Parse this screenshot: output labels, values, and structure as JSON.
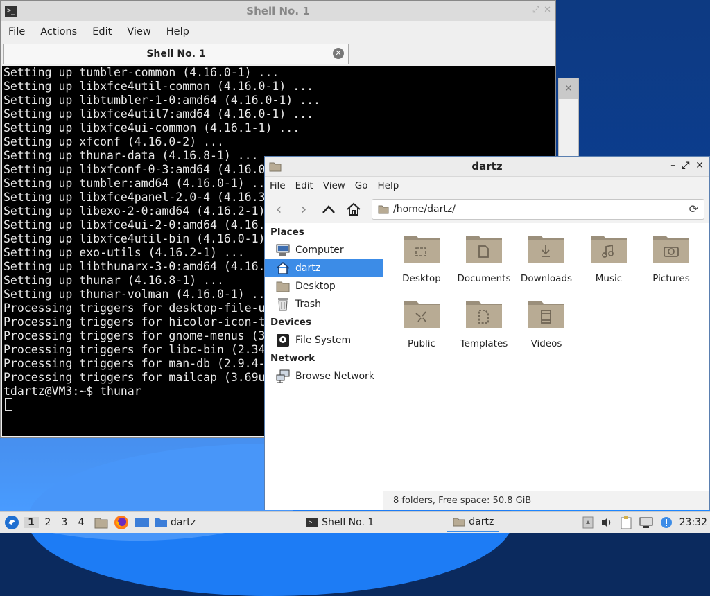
{
  "terminal": {
    "title": "Shell No. 1",
    "menu": [
      "File",
      "Actions",
      "Edit",
      "View",
      "Help"
    ],
    "tab_label": "Shell No. 1",
    "lines": [
      "Setting up tumbler-common (4.16.0-1) ...",
      "Setting up libxfce4util-common (4.16.0-1) ...",
      "Setting up libtumbler-1-0:amd64 (4.16.0-1) ...",
      "Setting up libxfce4util7:amd64 (4.16.0-1) ...",
      "Setting up libxfce4ui-common (4.16.1-1) ...",
      "Setting up xfconf (4.16.0-2) ...",
      "Setting up thunar-data (4.16.8-1) ...",
      "Setting up libxfconf-0-3:amd64 (4.16.0",
      "Setting up tumbler:amd64 (4.16.0-1) ...",
      "Setting up libxfce4panel-2.0-4 (4.16.3",
      "Setting up libexo-2-0:amd64 (4.16.2-1)",
      "Setting up libxfce4ui-2-0:amd64 (4.16.",
      "Setting up libxfce4util-bin (4.16.0-1)",
      "Setting up exo-utils (4.16.2-1) ...",
      "Setting up libthunarx-3-0:amd64 (4.16.",
      "Setting up thunar (4.16.8-1) ...",
      "Setting up thunar-volman (4.16.0-1) ...",
      "Processing triggers for desktop-file-u",
      "Processing triggers for hicolor-icon-t",
      "Processing triggers for gnome-menus (3",
      "Processing triggers for libc-bin (2.34",
      "Processing triggers for man-db (2.9.4-",
      "Processing triggers for mailcap (3.69u",
      "tdartz@VM3:~$ thunar"
    ]
  },
  "thunar": {
    "title": "dartz",
    "menu": [
      "File",
      "Edit",
      "Go",
      "Help"
    ],
    "menu_view": "View",
    "path": "/home/dartz/",
    "sidebar": {
      "places_header": "Places",
      "places": [
        "Computer",
        "dartz",
        "Desktop",
        "Trash"
      ],
      "devices_header": "Devices",
      "devices": [
        "File System"
      ],
      "network_header": "Network",
      "network": [
        "Browse Network"
      ]
    },
    "folders": [
      "Desktop",
      "Documents",
      "Downloads",
      "Music",
      "Pictures",
      "Public",
      "Templates",
      "Videos"
    ],
    "status": "8 folders, Free space: 50.8 GiB"
  },
  "taskbar": {
    "workspaces": [
      "1",
      "2",
      "3",
      "4"
    ],
    "quick_task": "dartz",
    "task_terminal": "Shell No. 1",
    "task_files": "dartz",
    "clock": "23:32"
  },
  "colors": {
    "selection": "#3c8ce7",
    "folder": "#b8ab94"
  }
}
